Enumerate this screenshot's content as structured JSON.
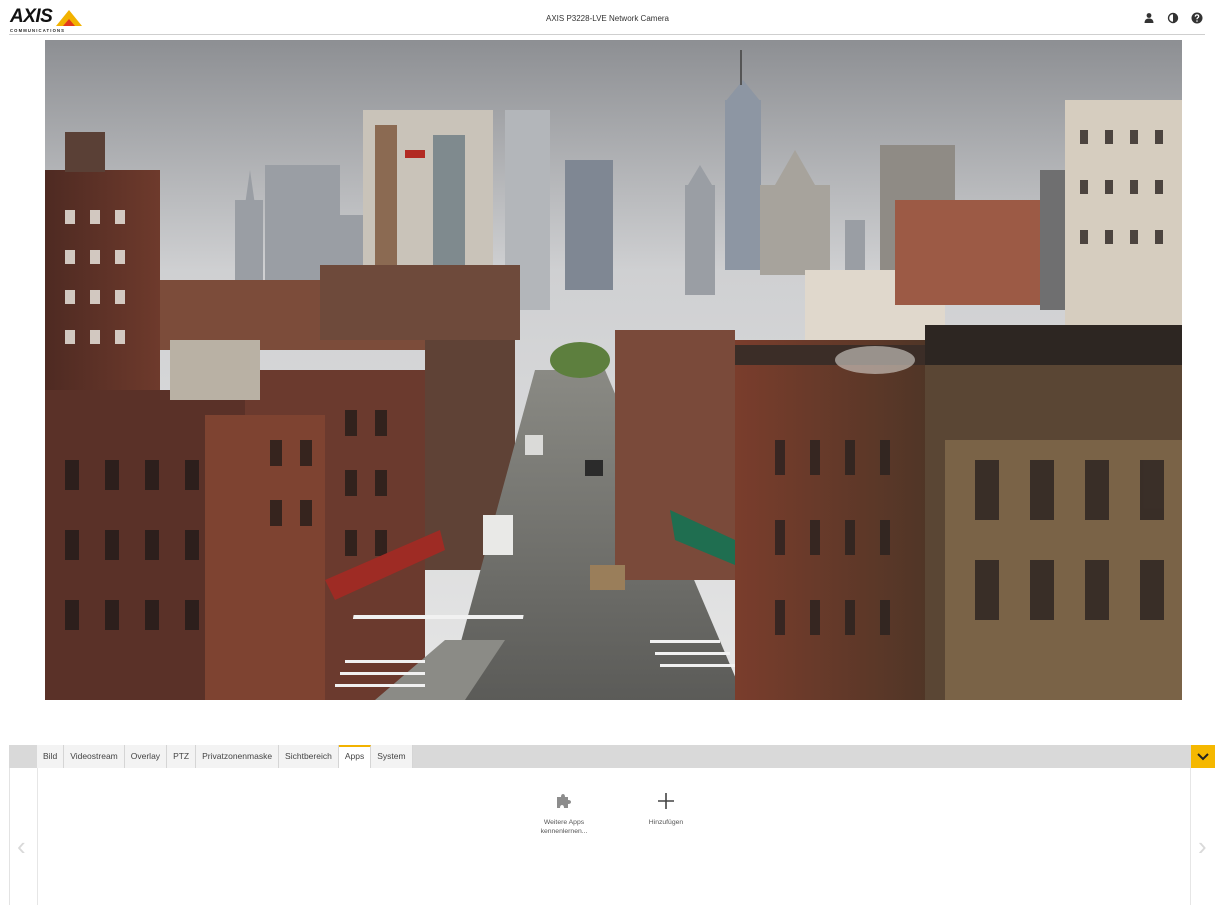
{
  "header": {
    "logo_text": "AXIS",
    "logo_subtext": "COMMUNICATIONS",
    "title": "AXIS P3228-LVE Network Camera",
    "icons": [
      "user-icon",
      "contrast-icon",
      "help-icon"
    ]
  },
  "colors": {
    "accent": "#f5b800",
    "tabbar": "#d9d9d9"
  },
  "tabs": [
    {
      "label": "Bild",
      "active": false
    },
    {
      "label": "Videostream",
      "active": false
    },
    {
      "label": "Overlay",
      "active": false
    },
    {
      "label": "PTZ",
      "active": false
    },
    {
      "label": "Privatzonenmaske",
      "active": false
    },
    {
      "label": "Sichtbereich",
      "active": false
    },
    {
      "label": "Apps",
      "active": true
    },
    {
      "label": "System",
      "active": false
    }
  ],
  "apps": {
    "explore_label": "Weitere Apps kennenlernen...",
    "explore_icon": "puzzle-icon",
    "add_label": "Hinzufügen",
    "add_icon": "plus-icon"
  }
}
